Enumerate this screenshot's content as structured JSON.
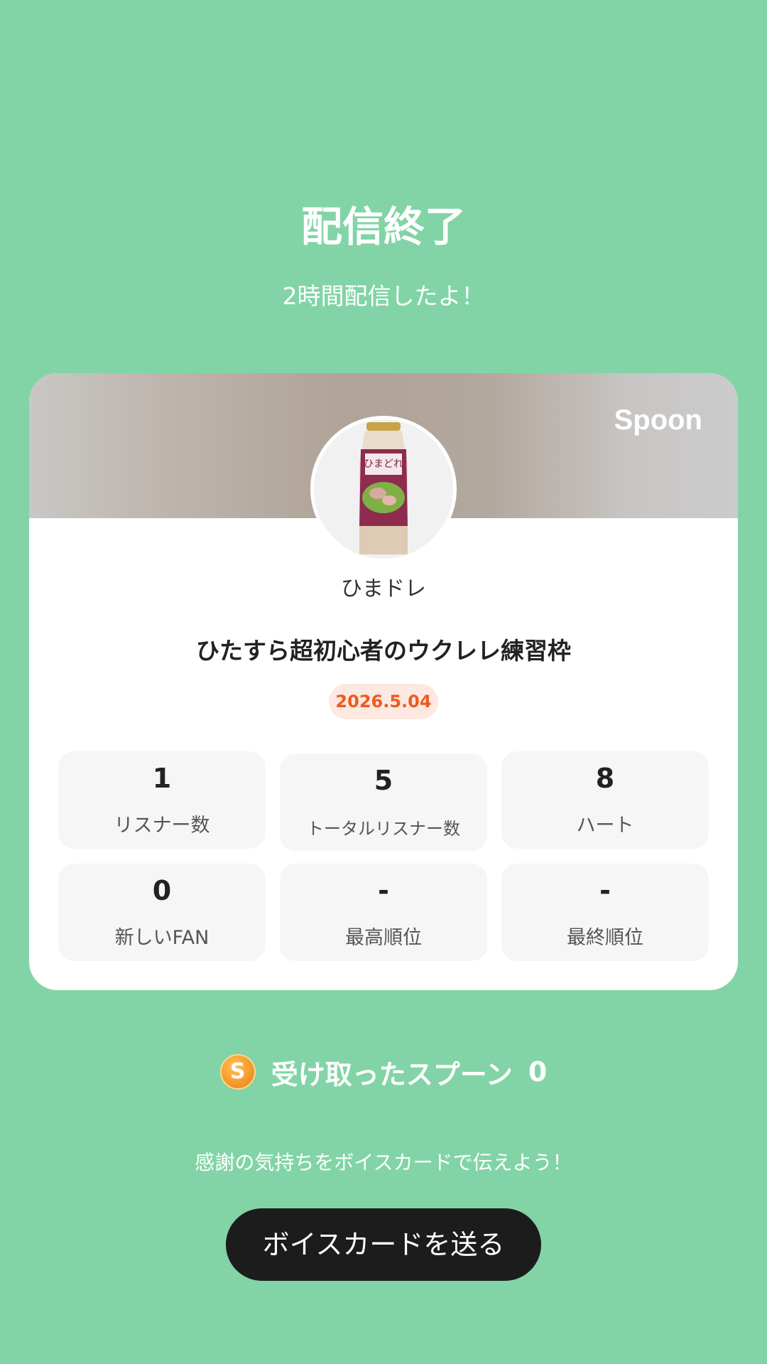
{
  "header": {
    "title": "配信終了",
    "subtitle": "2時間配信したよ！"
  },
  "card": {
    "brand": "Spoon",
    "dj_name": "ひまドレ",
    "stream_title": "ひたすら超初心者のウクレレ練習枠",
    "date": "2026.5.04",
    "stats": [
      {
        "value": "1",
        "label": "リスナー数"
      },
      {
        "value": "5",
        "label": "トータルリスナー数"
      },
      {
        "value": "8",
        "label": "ハート"
      },
      {
        "value": "0",
        "label": "新しいFAN"
      },
      {
        "value": "-",
        "label": "最高順位"
      },
      {
        "value": "-",
        "label": "最終順位"
      }
    ]
  },
  "spoons": {
    "coin_letter": "S",
    "label": "受け取ったスプーン",
    "count": "0"
  },
  "footer": {
    "thanks_text": "感謝の気持ちをボイスカードで伝えよう！",
    "button_label": "ボイスカードを送る"
  },
  "colors": {
    "background": "#82d4a7",
    "date_accent": "#ef5a1f",
    "button": "#1c1c1c"
  }
}
